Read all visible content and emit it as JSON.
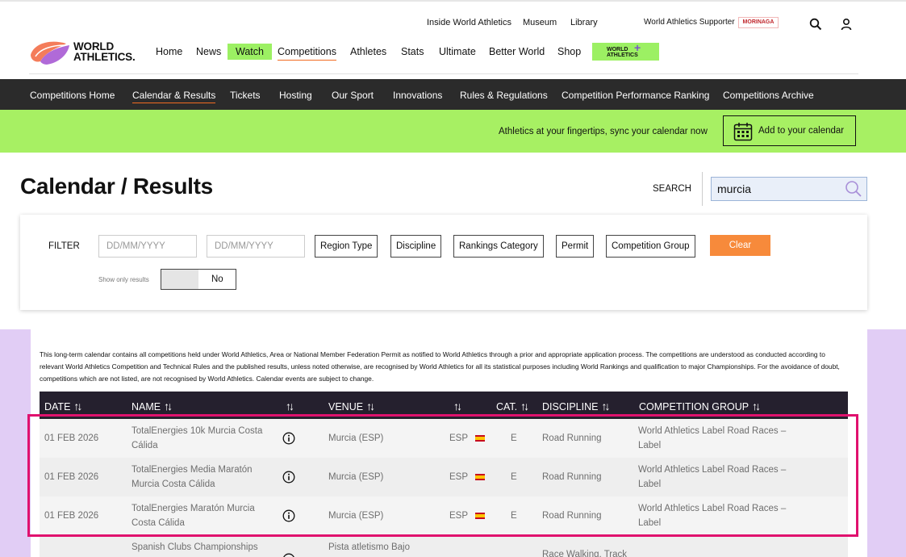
{
  "utility": {
    "links": [
      "Inside World Athletics",
      "Museum",
      "Library"
    ],
    "supporter_label": "World Athletics Supporter",
    "sponsor_logo": "MORINAGA"
  },
  "logo": {
    "line1": "WORLD",
    "line2": "ATHLETICS."
  },
  "main_nav": {
    "items": [
      "Home",
      "News",
      "Watch",
      "Competitions",
      "Athletes",
      "Stats",
      "Ultimate",
      "Better World",
      "Shop"
    ],
    "plus_badge": {
      "line1": "WORLD",
      "line2": "ATHLETICS"
    }
  },
  "sub_nav": {
    "items": [
      "Competitions Home",
      "Calendar & Results",
      "Tickets",
      "Hosting",
      "Our Sport",
      "Innovations",
      "Rules & Regulations",
      "Competition Performance Ranking",
      "Competitions Archive"
    ]
  },
  "banner": {
    "text": "Athletics at your fingertips, sync your calendar now",
    "button_label": "Add to your calendar"
  },
  "page": {
    "title": "Calendar / Results"
  },
  "search": {
    "label": "SEARCH",
    "value": "murcia"
  },
  "filter": {
    "label": "FILTER",
    "date_placeholder_from": "DD/MM/YYYY",
    "date_placeholder_to": "DD/MM/YYYY",
    "buttons": [
      "Region Type",
      "Discipline",
      "Rankings Category",
      "Permit",
      "Competition Group"
    ],
    "clear_label": "Clear",
    "show_only_results_label": "Show only results",
    "toggle_value": "No"
  },
  "disclaimer": "This long-term calendar contains all competitions held under World Athletics, Area or National Member Federation Permit as notified to World Athletics through a prior and appropriate application process. The competitions are understood as conducted according to relevant World Athletics Competition and Technical Rules and the published results, unless noted otherwise, are recognised by World Athletics for all its statistical purposes including World Rankings and qualification to major Championships. For the avoidance of doubt, competitions which are not listed, are not recognised by World Athletics. Calendar events are subject to change.",
  "table": {
    "headers": {
      "date": "DATE",
      "name": "NAME",
      "venue": "VENUE",
      "cat": "CAT.",
      "discipline": "DISCIPLINE",
      "group": "COMPETITION GROUP"
    },
    "rows": [
      {
        "date": "01 FEB 2026",
        "name": "TotalEnergies 10k Murcia Costa Cálida",
        "venue": "Murcia (ESP)",
        "country": "ESP",
        "cat": "E",
        "discipline": "Road Running",
        "group": "World Athletics Label Road Races – Label"
      },
      {
        "date": "01 FEB 2026",
        "name": "TotalEnergies Media Maratón Murcia Costa Cálida",
        "venue": "Murcia (ESP)",
        "country": "ESP",
        "cat": "E",
        "discipline": "Road Running",
        "group": "World Athletics Label Road Races – Label"
      },
      {
        "date": "01 FEB 2026",
        "name": "TotalEnergies Maratón Murcia Costa Cálida",
        "venue": "Murcia (ESP)",
        "country": "ESP",
        "cat": "E",
        "discipline": "Road Running",
        "group": "World Athletics Label Road Races – Label"
      },
      {
        "date": "",
        "name": "Spanish Clubs Championships",
        "venue": "Pista atletismo Bajo",
        "country": "",
        "cat": "",
        "discipline": "Race Walking, Track",
        "group": ""
      }
    ]
  },
  "colors": {
    "accent_green": "#a7f063",
    "accent_orange": "#f78a3b",
    "highlight": "#e0116e",
    "table_header": "#25202e",
    "results_bg": "#e1cdf5"
  }
}
